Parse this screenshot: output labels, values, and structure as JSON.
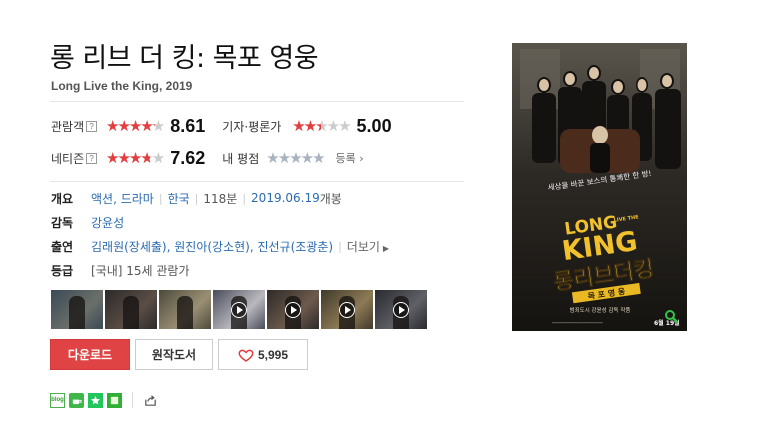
{
  "movie": {
    "title": "롱 리브 더 킹: 목포 영웅",
    "subtitle": "Long Live the King, 2019"
  },
  "ratings": {
    "audience": {
      "label": "관람객",
      "help_icon": "?",
      "stars_fraction": 0.86,
      "score": "8.61"
    },
    "critics": {
      "label": "기자·평론가",
      "stars_fraction": 0.5,
      "score": "5.00"
    },
    "netizen": {
      "label": "네티즌",
      "help_icon": "?",
      "stars_fraction": 0.76,
      "score": "7.62"
    },
    "mine": {
      "label": "내 평점",
      "stars_fraction": 0,
      "register_label": "등록"
    },
    "colors": {
      "filled": "#e63e3e",
      "empty": "#cccccc",
      "mine": "#a8b3c0"
    }
  },
  "info": {
    "overview_key": "개요",
    "genre": "액션, 드라마",
    "country": "한국",
    "runtime": "118분",
    "release_date": "2019.06.19",
    "release_suffix": "개봉",
    "director_key": "감독",
    "director": "강윤성",
    "cast_key": "출연",
    "cast": "김래원(장세출), 원진아(강소현), 진선규(조광춘)",
    "cast_more": "더보기",
    "grade_key": "등급",
    "grade": "[국내] 15세 관람가"
  },
  "thumbnails": [
    {
      "kind": "photo",
      "colors": [
        "#3a4a55",
        "#6b6f6a"
      ]
    },
    {
      "kind": "photo",
      "colors": [
        "#2c2a2a",
        "#5a4d45"
      ]
    },
    {
      "kind": "photo",
      "colors": [
        "#4d4a3c",
        "#9a8f74"
      ]
    },
    {
      "kind": "video",
      "colors": [
        "#4a4d5a",
        "#b9b8be"
      ]
    },
    {
      "kind": "video",
      "colors": [
        "#2e2a28",
        "#6d5a4c"
      ]
    },
    {
      "kind": "video",
      "colors": [
        "#3f3a2a",
        "#8d7a55"
      ]
    },
    {
      "kind": "video",
      "colors": [
        "#2a2a30",
        "#5e6066"
      ]
    }
  ],
  "buttons": {
    "download": "다운로드",
    "original_book": "원작도서",
    "like_count": "5,995"
  },
  "share": {
    "blog": "blog",
    "icons": [
      "blog-icon",
      "cafe-icon",
      "band-icon",
      "kakao-icon",
      "share-icon"
    ]
  },
  "poster": {
    "tagline": "세상을 바꾼 보스의 통쾌한 한 방!",
    "logo_en_line1": "LONG",
    "logo_en_line2": "LIVE THE",
    "logo_en_line3": "KING",
    "logo_kr": "롱리브더킹",
    "logo_sub": "목 포 영 웅",
    "credit": "범죄도시 강윤성 감독 작품",
    "release": "6월 19일"
  }
}
